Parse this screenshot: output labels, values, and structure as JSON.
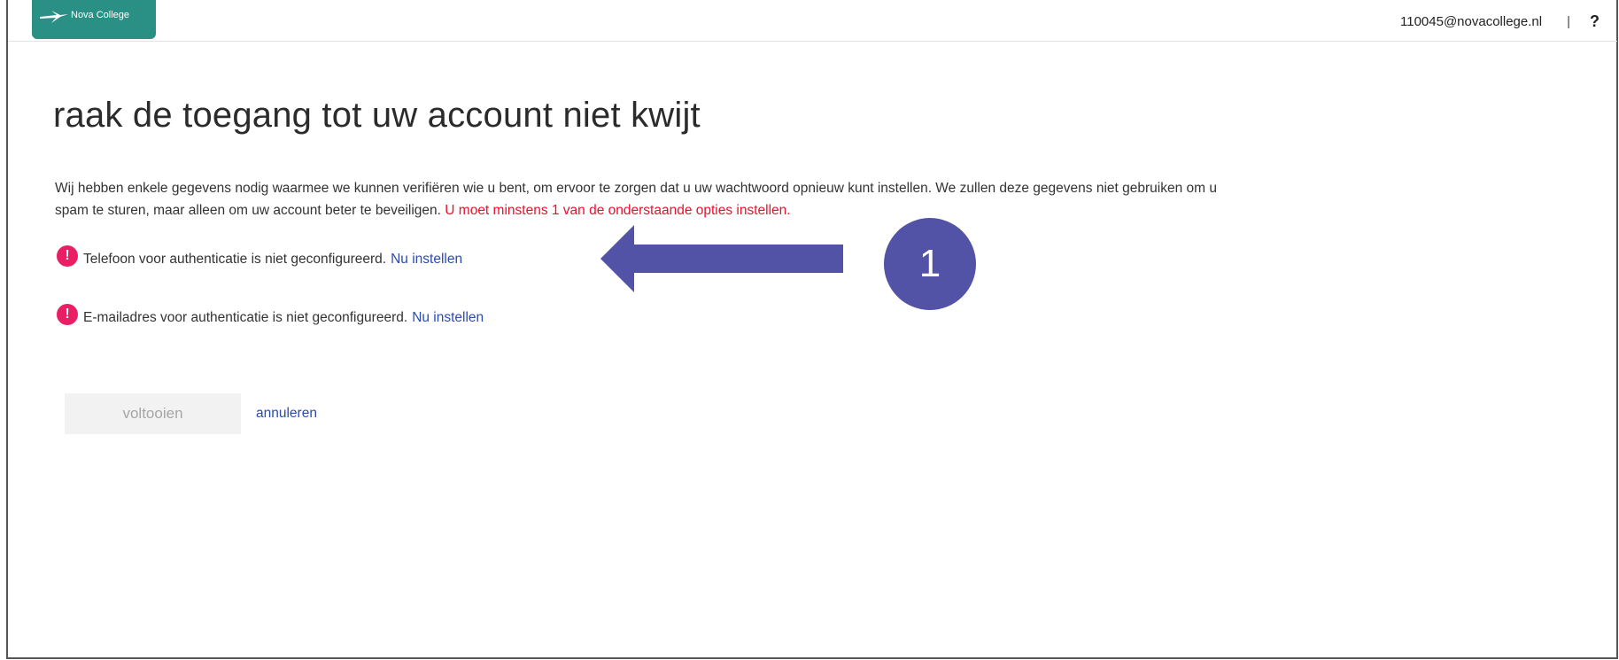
{
  "header": {
    "logo_text": "Nova College",
    "user_email": "110045@novacollege.nl",
    "separator": "|",
    "help_label": "?"
  },
  "main": {
    "title": "raak de toegang tot uw account niet kwijt",
    "intro_text": "Wij hebben enkele gegevens nodig waarmee we kunnen verifiëren wie u bent, om ervoor te zorgen dat u uw wachtwoord opnieuw kunt instellen. We zullen deze gegevens niet gebruiken om u spam te sturen, maar alleen om uw account beter te beveiligen. ",
    "requirement_text": "U moet minstens 1 van de onderstaande opties instellen.",
    "options": [
      {
        "text": "Telefoon voor authenticatie is niet geconfigureerd.",
        "link": "Nu instellen",
        "icon": "alert-icon"
      },
      {
        "text": "E-mailadres voor authenticatie is niet geconfigureerd.",
        "link": "Nu instellen",
        "icon": "alert-icon"
      }
    ],
    "finish_label": "voltooien",
    "cancel_label": "annuleren"
  },
  "annotation": {
    "step_number": "1",
    "color": "#5253a6"
  },
  "colors": {
    "brand": "#2a9085",
    "link": "#2a4bb0",
    "warning": "#e8112d",
    "alert_icon": "#e91e63"
  }
}
